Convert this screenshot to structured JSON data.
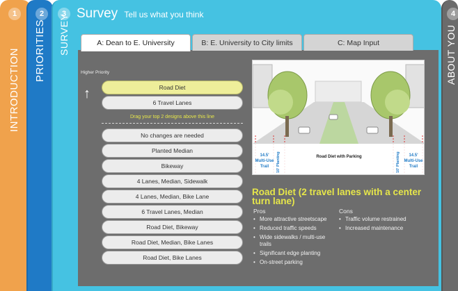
{
  "steps": [
    {
      "num": "1",
      "label": "INTRODUCTION"
    },
    {
      "num": "2",
      "label": "PRIORITIES"
    },
    {
      "num": "3",
      "label": "SURVEY"
    },
    {
      "num": "4",
      "label": "ABOUT YOU"
    }
  ],
  "survey": {
    "title": "Survey",
    "subtitle": "Tell us what you think"
  },
  "tabs": [
    {
      "label": "A: Dean to E. University",
      "active": true
    },
    {
      "label": "B: E. University to City limits",
      "active": false
    },
    {
      "label": "C: Map Input",
      "active": false
    }
  ],
  "priority_hint": "Higher Priority",
  "top_choices": [
    "Road Diet",
    "6 Travel Lanes"
  ],
  "drag_hint": "Drag your top 2 designs above this line",
  "options": [
    "No changes are needed",
    "Planted Median",
    "Bikeway",
    "4 Lanes, Median, Sidewalk",
    "4 Lanes, Median, Bike Lane",
    "6 Travel Lanes, Median",
    "Road Diet, Bikeway",
    "Road Diet, Median, Bike Lanes",
    "Road Diet, Bike Lanes"
  ],
  "diagram": {
    "center_label": "Road Diet with Parking",
    "left_trail": [
      "14.5'",
      "Multi-Use",
      "Trail"
    ],
    "right_trail": [
      "14.5'",
      "Multi-Use",
      "Trail"
    ],
    "planting": "10' Planting"
  },
  "design": {
    "title": "Road Diet (2 travel lanes with a center turn lane)",
    "pros_label": "Pros",
    "cons_label": "Cons",
    "pros": [
      "More attractive streetscape",
      "Reduced traffic speeds",
      "Wide sidewalks / multi-use trails",
      "Significant edge planting",
      "On-street parking"
    ],
    "cons": [
      "Traffic volume restrained",
      "Increased maintenance"
    ]
  },
  "colors": {
    "intro_rail": "#f0a24c",
    "priorities_rail": "#1f7ac6",
    "survey_rail": "#45c2e2",
    "about_rail": "#6b6b6b",
    "highlight_text": "#e6e64a",
    "selected_pill": "#eeee9a"
  }
}
